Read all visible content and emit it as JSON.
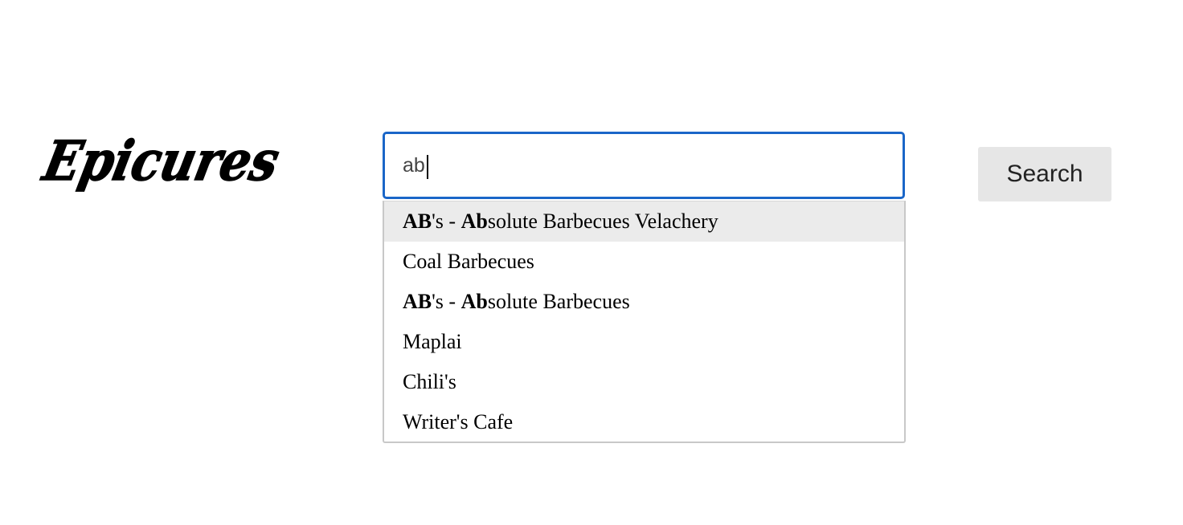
{
  "logo": {
    "text": "Epicures"
  },
  "search": {
    "value": "ab",
    "button_label": "Search"
  },
  "suggestions": [
    {
      "parts": [
        {
          "text": "AB",
          "bold": true
        },
        {
          "text": "'s - ",
          "bold": false
        },
        {
          "text": "Ab",
          "bold": true
        },
        {
          "text": "solute Barbecues Velachery",
          "bold": false
        }
      ],
      "active": true
    },
    {
      "parts": [
        {
          "text": "Coal Barbecues",
          "bold": false
        }
      ],
      "active": false
    },
    {
      "parts": [
        {
          "text": "AB",
          "bold": true
        },
        {
          "text": "'s - ",
          "bold": false
        },
        {
          "text": "Ab",
          "bold": true
        },
        {
          "text": "solute Barbecues",
          "bold": false
        }
      ],
      "active": false
    },
    {
      "parts": [
        {
          "text": "Maplai",
          "bold": false
        }
      ],
      "active": false
    },
    {
      "parts": [
        {
          "text": "Chili's",
          "bold": false
        }
      ],
      "active": false
    },
    {
      "parts": [
        {
          "text": "Writer's Cafe",
          "bold": false
        }
      ],
      "active": false
    }
  ]
}
